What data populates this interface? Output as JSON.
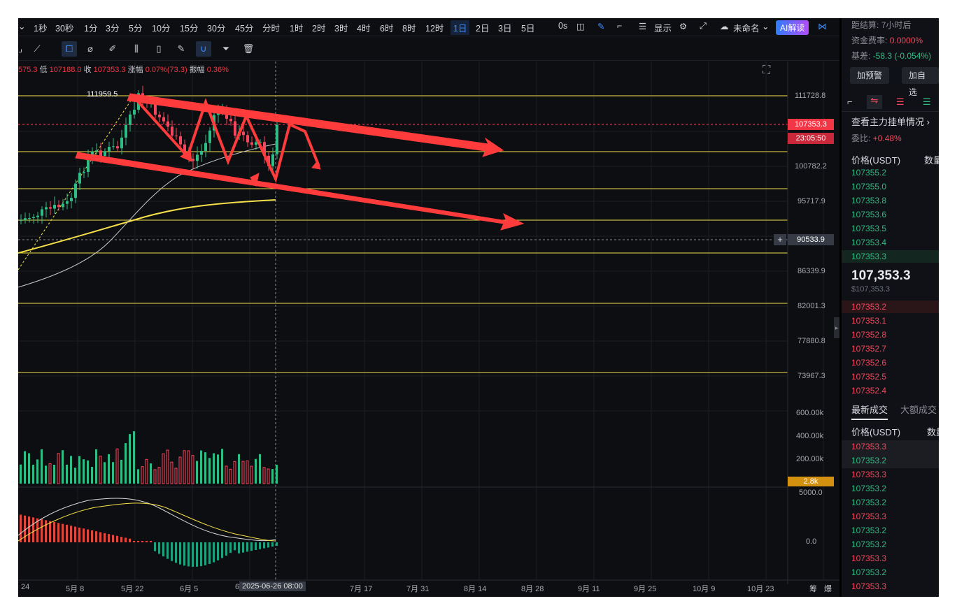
{
  "top_bar": {
    "intervals": [
      "1秒",
      "30秒",
      "1分",
      "3分",
      "5分",
      "10分",
      "15分",
      "30分",
      "45分",
      "分时",
      "1时",
      "2时",
      "3时",
      "4时",
      "6时",
      "8时",
      "12时",
      "1日",
      "2日",
      "3日",
      "5日"
    ],
    "active_interval": "1日",
    "seconds_label": "0s",
    "display_label": "显示",
    "layout_name": "未命名",
    "ai_label": "AI解读"
  },
  "ohlc": {
    "high_partial": "575.3",
    "low_label": "低",
    "low": "107188.0",
    "close_label": "收",
    "close": "107353.3",
    "change_label": "涨幅",
    "change": "0.07%(73.3)",
    "amplitude_label": "振幅",
    "amplitude": "0.36%"
  },
  "chart": {
    "high_marker": "111959.5",
    "price_ticks": [
      "111728.8",
      "100782.2",
      "95717.9",
      "90533.9",
      "86339.9",
      "82001.3",
      "77880.8",
      "73967.3"
    ],
    "last_price": "107353.3",
    "countdown": "23:05:50",
    "crosshair_price": "90533.9",
    "volume_ticks": [
      "600.00k",
      "400.00k",
      "200.00k"
    ],
    "volume_tag": "2.8k",
    "macd_ticks": [
      "5000.0",
      "0.0"
    ],
    "date_ticks": [
      "24",
      "5月 8",
      "5月 22",
      "6月 5",
      "6",
      "7月 17",
      "7月 31",
      "8月 14",
      "8月 28",
      "9月 11",
      "9月 25",
      "10月 9",
      "10月 23"
    ],
    "crosshair_date": "2025-06-26 08:00",
    "corner_labels": [
      "筹",
      "爆"
    ]
  },
  "right_panel": {
    "settlement_label": "距结算:",
    "settlement_value": "7小时后",
    "funding_label": "资金费率:",
    "funding_value": "0.0000%",
    "basis_label": "基差:",
    "basis_value": "-58.3 (-0.054%)",
    "alert_button": "加预警",
    "watch_button": "加自选",
    "orders_link": "查看主力挂单情况",
    "ratio_label": "委比:",
    "ratio_value": "+0.48%",
    "price_header": "价格(USDT)",
    "qty_header": "数量",
    "asks": [
      "107355.2",
      "107355.0",
      "107353.8",
      "107353.6",
      "107353.5",
      "107353.4",
      "107353.3"
    ],
    "mid_price": "107,353.3",
    "mid_usd": "$107,353.3",
    "bids": [
      "107353.2",
      "107353.1",
      "107352.8",
      "107352.7",
      "107352.6",
      "107352.5",
      "107352.4"
    ],
    "trades_tab": "最新成交",
    "big_trades_tab": "大额成交",
    "trades": [
      {
        "price": "107353.3",
        "side": "red"
      },
      {
        "price": "107353.2",
        "side": "green"
      },
      {
        "price": "107353.3",
        "side": "red"
      },
      {
        "price": "107353.2",
        "side": "green"
      },
      {
        "price": "107353.2",
        "side": "green"
      },
      {
        "price": "107353.3",
        "side": "red"
      },
      {
        "price": "107353.2",
        "side": "green"
      },
      {
        "price": "107353.2",
        "side": "green"
      },
      {
        "price": "107353.3",
        "side": "red"
      },
      {
        "price": "107353.2",
        "side": "green"
      },
      {
        "price": "107353.3",
        "side": "red"
      }
    ]
  },
  "colors": {
    "up": "#2ebd85",
    "down": "#f6465d",
    "accent": "#3d8bfd",
    "hline": "#f5e04a",
    "arrow": "#ff3b3b"
  }
}
